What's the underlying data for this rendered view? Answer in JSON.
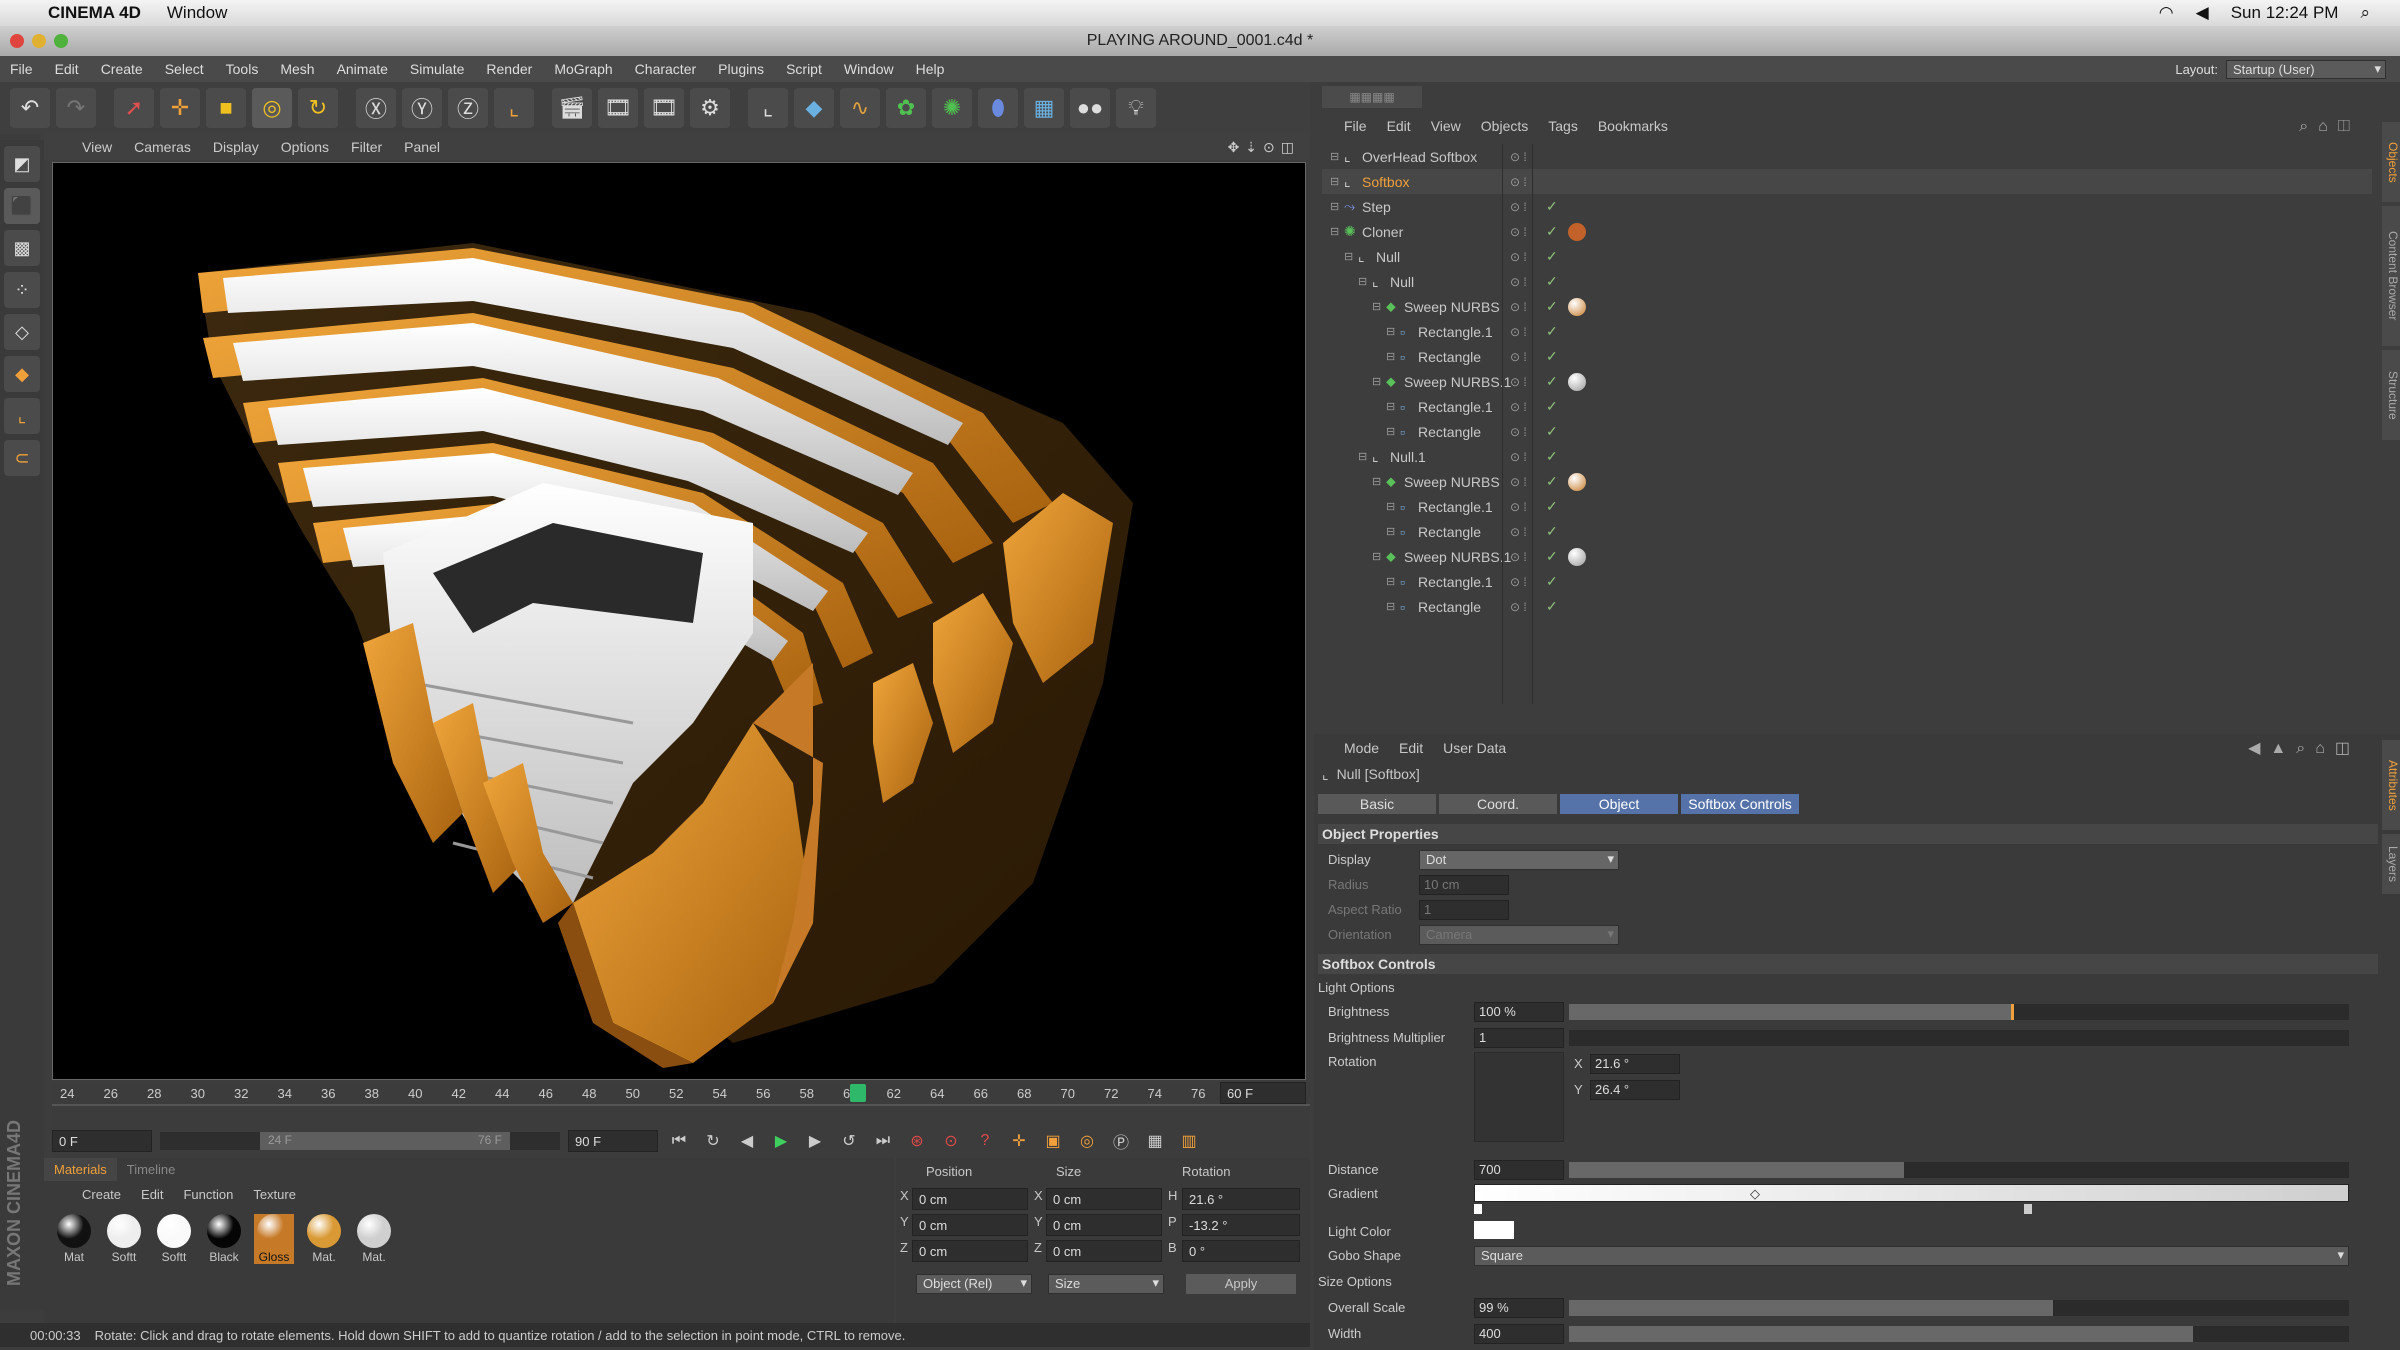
{
  "os": {
    "app": "CINEMA 4D",
    "window_menu": "Window",
    "clock": "Sun 12:24 PM"
  },
  "window": {
    "title": "PLAYING AROUND_0001.c4d *"
  },
  "menubar": {
    "items": [
      "File",
      "Edit",
      "Create",
      "Select",
      "Tools",
      "Mesh",
      "Animate",
      "Simulate",
      "Render",
      "MoGraph",
      "Character",
      "Plugins",
      "Script",
      "Window",
      "Help"
    ],
    "layout_label": "Layout:",
    "layout_value": "Startup (User)"
  },
  "viewport": {
    "menu": [
      "View",
      "Cameras",
      "Display",
      "Options",
      "Filter",
      "Panel"
    ]
  },
  "timeline": {
    "ticks": [
      "24",
      "26",
      "28",
      "30",
      "32",
      "34",
      "36",
      "38",
      "40",
      "42",
      "44",
      "46",
      "48",
      "50",
      "52",
      "54",
      "56",
      "58",
      "60",
      "62",
      "64",
      "66",
      "68",
      "70",
      "72",
      "74",
      "76"
    ],
    "current": "60 F",
    "start": "0 F",
    "range_start": "24 F",
    "range_end": "76 F",
    "end": "90 F"
  },
  "materials": {
    "tabs": [
      "Materials",
      "Timeline"
    ],
    "menu": [
      "Create",
      "Edit",
      "Function",
      "Texture"
    ],
    "items": [
      {
        "name": "Mat",
        "color": "#111"
      },
      {
        "name": "Softt",
        "color": "#eee"
      },
      {
        "name": "Softt",
        "color": "#fafafa"
      },
      {
        "name": "Black",
        "color": "#050505"
      },
      {
        "name": "Gloss",
        "color": "#c67a28"
      },
      {
        "name": "Mat.",
        "color": "#d99a35"
      },
      {
        "name": "Mat.",
        "color": "#cfcfcf"
      }
    ]
  },
  "coords": {
    "headers": [
      "Position",
      "Size",
      "Rotation"
    ],
    "rows": [
      {
        "a": "X",
        "pos": "0 cm",
        "b": "X",
        "size": "0 cm",
        "c": "H",
        "rot": "21.6 °"
      },
      {
        "a": "Y",
        "pos": "0 cm",
        "b": "Y",
        "size": "0 cm",
        "c": "P",
        "rot": "-13.2 °"
      },
      {
        "a": "Z",
        "pos": "0 cm",
        "b": "Z",
        "size": "0 cm",
        "c": "B",
        "rot": "0 °"
      }
    ],
    "mode": "Object (Rel)",
    "size_mode": "Size",
    "apply": "Apply"
  },
  "status": {
    "time": "00:00:33",
    "text": "Rotate: Click and drag to rotate elements. Hold down SHIFT to add to quantize rotation / add to the selection in point mode, CTRL to remove."
  },
  "objects": {
    "menu": [
      "File",
      "Edit",
      "View",
      "Objects",
      "Tags",
      "Bookmarks"
    ],
    "tree": [
      {
        "name": "OverHead Softbox",
        "indent": 0,
        "orange": false
      },
      {
        "name": "Softbox",
        "indent": 0,
        "orange": true
      },
      {
        "name": "Step",
        "indent": 0,
        "orange": false
      },
      {
        "name": "Cloner",
        "indent": 0,
        "orange": false
      },
      {
        "name": "Null",
        "indent": 1,
        "orange": false
      },
      {
        "name": "Null",
        "indent": 2,
        "orange": false
      },
      {
        "name": "Sweep NURBS",
        "indent": 3,
        "orange": false
      },
      {
        "name": "Rectangle.1",
        "indent": 4,
        "orange": false
      },
      {
        "name": "Rectangle",
        "indent": 4,
        "orange": false
      },
      {
        "name": "Sweep NURBS.1",
        "indent": 3,
        "orange": false
      },
      {
        "name": "Rectangle.1",
        "indent": 4,
        "orange": false
      },
      {
        "name": "Rectangle",
        "indent": 4,
        "orange": false
      },
      {
        "name": "Null.1",
        "indent": 2,
        "orange": false
      },
      {
        "name": "Sweep NURBS",
        "indent": 3,
        "orange": false
      },
      {
        "name": "Rectangle.1",
        "indent": 4,
        "orange": false
      },
      {
        "name": "Rectangle",
        "indent": 4,
        "orange": false
      },
      {
        "name": "Sweep NURBS.1",
        "indent": 3,
        "orange": false
      },
      {
        "name": "Rectangle.1",
        "indent": 4,
        "orange": false
      },
      {
        "name": "Rectangle",
        "indent": 4,
        "orange": false
      }
    ]
  },
  "attributes": {
    "menu": [
      "Mode",
      "Edit",
      "User Data"
    ],
    "object_name": "Null [Softbox]",
    "tabs": [
      "Basic",
      "Coord.",
      "Object",
      "Softbox Controls"
    ],
    "sections": {
      "object_properties": "Object Properties",
      "softbox_controls": "Softbox Controls",
      "light_options": "Light Options",
      "size_options": "Size Options"
    },
    "props": {
      "display_label": "Display",
      "display": "Dot",
      "radius_label": "Radius",
      "radius": "10 cm",
      "aspect_label": "Aspect Ratio",
      "aspect": "1",
      "orientation_label": "Orientation",
      "orientation": "Camera",
      "brightness_label": "Brightness",
      "brightness": "100 %",
      "brightness_level": 0.57,
      "multiplier_label": "Brightness Multiplier",
      "multiplier": "1",
      "rotation_label": "Rotation",
      "rot_x_label": "X",
      "rot_x": "21.6 °",
      "rot_y_label": "Y",
      "rot_y": "26.4 °",
      "distance_label": "Distance",
      "distance": "700",
      "distance_level": 0.43,
      "gradient_label": "Gradient",
      "light_color_label": "Light Color",
      "gobo_label": "Gobo Shape",
      "gobo": "Square",
      "overall_scale_label": "Overall Scale",
      "overall_scale": "99 %",
      "overall_scale_level": 0.62,
      "width_label": "Width",
      "width": "400",
      "width_level": 0.8
    },
    "side_tabs": [
      "Attributes",
      "Layers"
    ]
  },
  "object_side_tabs": [
    "Objects",
    "Content Browser",
    "Structure"
  ],
  "colors": {
    "accent": "#f0a03a",
    "tab_active": "#5573a8",
    "check": "#8ec27a"
  }
}
